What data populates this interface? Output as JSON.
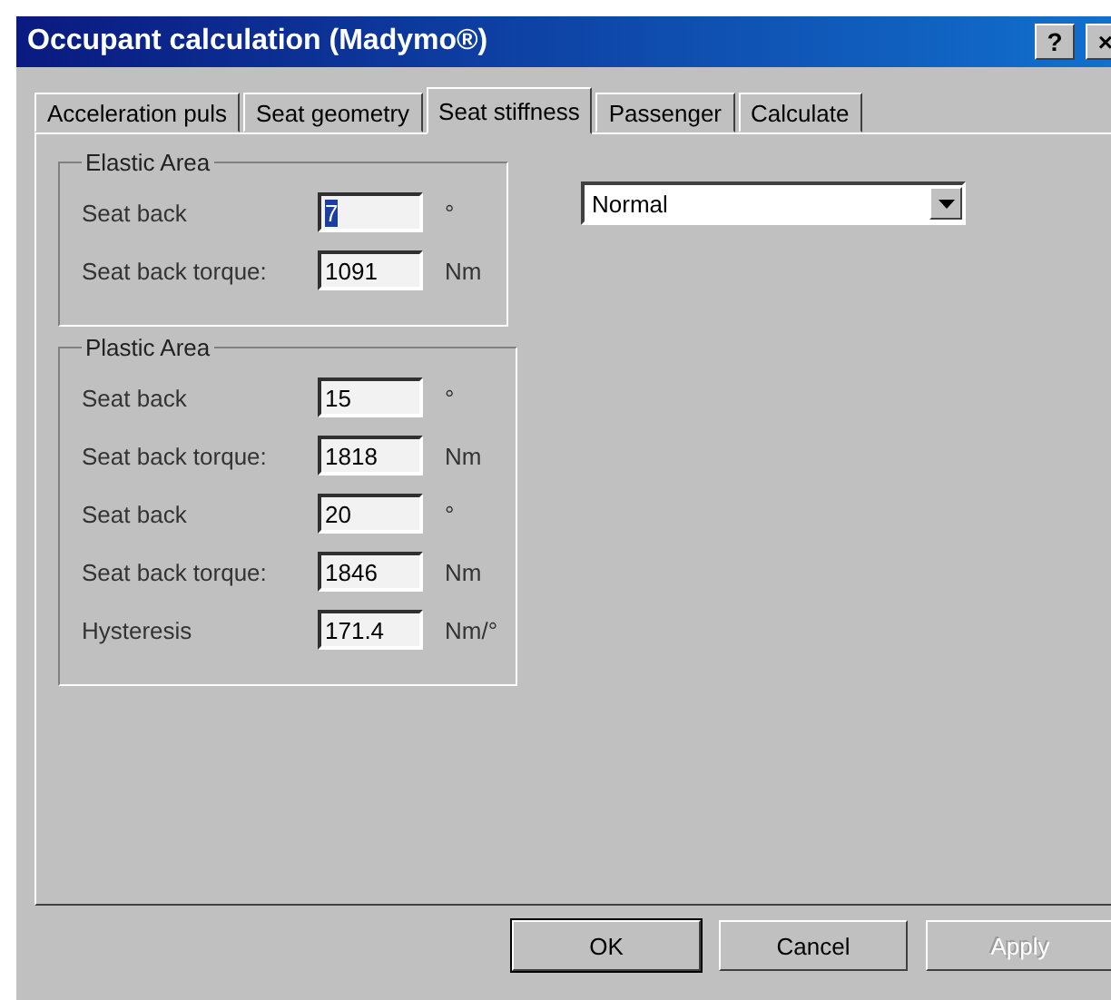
{
  "window": {
    "title": "Occupant calculation (Madymo®)",
    "help": "?",
    "close": "×"
  },
  "tabs": [
    {
      "label": "Acceleration puls",
      "selected": false
    },
    {
      "label": "Seat geometry",
      "selected": false
    },
    {
      "label": "Seat stiffness",
      "selected": true
    },
    {
      "label": "Passenger",
      "selected": false
    },
    {
      "label": "Calculate",
      "selected": false
    }
  ],
  "groups": [
    {
      "title": "Elastic Area",
      "fields": [
        {
          "label": "Seat back",
          "value": "7",
          "unit": "°",
          "selected": true
        },
        {
          "label": "Seat back torque:",
          "value": "1091",
          "unit": "Nm",
          "selected": false
        }
      ]
    },
    {
      "title": "Plastic Area",
      "fields": [
        {
          "label": "Seat back",
          "value": "15",
          "unit": "°",
          "selected": false
        },
        {
          "label": "Seat back torque:",
          "value": "1818",
          "unit": "Nm",
          "selected": false
        },
        {
          "label": "Seat back",
          "value": "20",
          "unit": "°",
          "selected": false
        },
        {
          "label": "Seat back torque:",
          "value": "1846",
          "unit": "Nm",
          "selected": false
        },
        {
          "label": "Hysteresis",
          "value": "171.4",
          "unit": "Nm/°",
          "selected": false
        }
      ]
    }
  ],
  "dropdown": {
    "value": "Normal"
  },
  "buttons": [
    {
      "label": "OK",
      "disabled": false,
      "default": true
    },
    {
      "label": "Cancel",
      "disabled": false,
      "default": false
    },
    {
      "label": "Apply",
      "disabled": true,
      "default": false
    }
  ]
}
